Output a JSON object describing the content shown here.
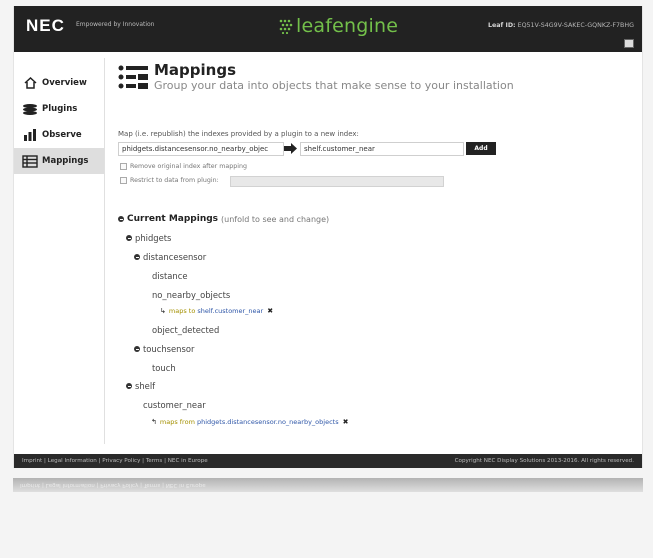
{
  "header": {
    "logo": "NEC",
    "tagline": "Empowered by Innovation",
    "brand": "leafengine",
    "leaf_id_label": "Leaf ID:",
    "leaf_id_value": "EQ51V-S4G9V-SAKEC-GQNKZ-F7BHG",
    "colors": {
      "bar": "#222222",
      "brand": "#73c04a"
    }
  },
  "sidebar": {
    "items": [
      {
        "label": "Overview",
        "icon": "home-icon"
      },
      {
        "label": "Plugins",
        "icon": "stack-icon"
      },
      {
        "label": "Observe",
        "icon": "bar-chart-icon"
      },
      {
        "label": "Mappings",
        "icon": "mappings-icon",
        "active": true
      }
    ]
  },
  "main": {
    "title": "Mappings",
    "subtitle": "Group your data into objects that make sense to your installation",
    "description": "Map (i.e. republish) the indexes provided by a plugin to a new index:",
    "source_value": "phidgets.distancesensor.no_nearby_objec",
    "target_value": "shelf.customer_near",
    "add_label": "Add",
    "remove_option": "Remove original index after mapping",
    "restrict_option": "Restrict to data from plugin:"
  },
  "tree": {
    "title": "Current Mappings",
    "note": "(unfold to see and change)",
    "phidgets": "phidgets",
    "distancesensor": "distancesensor",
    "distance": "distance",
    "no_nearby_objects": "no_nearby_objects",
    "maps_to_prefix": "maps to",
    "maps_to_target": "shelf.customer_near",
    "object_detected": "object_detected",
    "touchsensor": "touchsensor",
    "touch": "touch",
    "shelf": "shelf",
    "customer_near": "customer_near",
    "maps_from_prefix": "maps from",
    "maps_from_source": "phidgets.distancesensor.no_nearby_objects"
  },
  "footer": {
    "links": "Imprint  |  Legal Information  |  Privacy Policy  |  Terms  |  NEC in Europe",
    "copyright": "Copyright NEC Display Solutions 2013-2016. All rights reserved."
  }
}
